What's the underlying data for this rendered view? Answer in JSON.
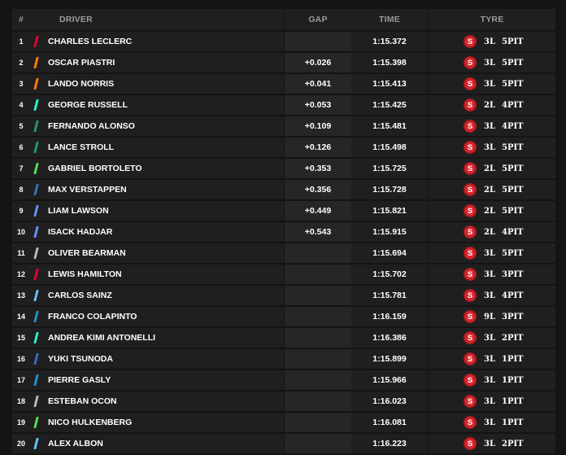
{
  "header": {
    "pos": "#",
    "driver": "DRIVER",
    "gap": "GAP",
    "time": "TIME",
    "tyre": "TYRE"
  },
  "rows": [
    {
      "pos": "1",
      "driver": "CHARLES LECLERC",
      "gap": "",
      "time": "1:15.372",
      "compound": "S",
      "laps": "3L",
      "pits": "5PIT",
      "team_color": "#e8002d"
    },
    {
      "pos": "2",
      "driver": "OSCAR PIASTRI",
      "gap": "+0.026",
      "time": "1:15.398",
      "compound": "S",
      "laps": "3L",
      "pits": "5PIT",
      "team_color": "#ff8000"
    },
    {
      "pos": "3",
      "driver": "LANDO NORRIS",
      "gap": "+0.041",
      "time": "1:15.413",
      "compound": "S",
      "laps": "3L",
      "pits": "5PIT",
      "team_color": "#ff8000"
    },
    {
      "pos": "4",
      "driver": "GEORGE RUSSELL",
      "gap": "+0.053",
      "time": "1:15.425",
      "compound": "S",
      "laps": "2L",
      "pits": "4PIT",
      "team_color": "#27f4d2"
    },
    {
      "pos": "5",
      "driver": "FERNANDO ALONSO",
      "gap": "+0.109",
      "time": "1:15.481",
      "compound": "S",
      "laps": "3L",
      "pits": "4PIT",
      "team_color": "#229971"
    },
    {
      "pos": "6",
      "driver": "LANCE STROLL",
      "gap": "+0.126",
      "time": "1:15.498",
      "compound": "S",
      "laps": "3L",
      "pits": "5PIT",
      "team_color": "#229971"
    },
    {
      "pos": "7",
      "driver": "GABRIEL BORTOLETO",
      "gap": "+0.353",
      "time": "1:15.725",
      "compound": "S",
      "laps": "2L",
      "pits": "5PIT",
      "team_color": "#52e252"
    },
    {
      "pos": "8",
      "driver": "MAX VERSTAPPEN",
      "gap": "+0.356",
      "time": "1:15.728",
      "compound": "S",
      "laps": "2L",
      "pits": "5PIT",
      "team_color": "#3671c6"
    },
    {
      "pos": "9",
      "driver": "LIAM LAWSON",
      "gap": "+0.449",
      "time": "1:15.821",
      "compound": "S",
      "laps": "2L",
      "pits": "5PIT",
      "team_color": "#6692ff"
    },
    {
      "pos": "10",
      "driver": "ISACK HADJAR",
      "gap": "+0.543",
      "time": "1:15.915",
      "compound": "S",
      "laps": "2L",
      "pits": "4PIT",
      "team_color": "#6692ff"
    },
    {
      "pos": "11",
      "driver": "OLIVER BEARMAN",
      "gap": "",
      "time": "1:15.694",
      "compound": "S",
      "laps": "3L",
      "pits": "5PIT",
      "team_color": "#b6babd"
    },
    {
      "pos": "12",
      "driver": "LEWIS HAMILTON",
      "gap": "",
      "time": "1:15.702",
      "compound": "S",
      "laps": "3L",
      "pits": "3PIT",
      "team_color": "#e8002d"
    },
    {
      "pos": "13",
      "driver": "CARLOS SAINZ",
      "gap": "",
      "time": "1:15.781",
      "compound": "S",
      "laps": "3L",
      "pits": "4PIT",
      "team_color": "#64c4ff"
    },
    {
      "pos": "14",
      "driver": "FRANCO COLAPINTO",
      "gap": "",
      "time": "1:16.159",
      "compound": "S",
      "laps": "9L",
      "pits": "3PIT",
      "team_color": "#2293d1"
    },
    {
      "pos": "15",
      "driver": "ANDREA KIMI ANTONELLI",
      "gap": "",
      "time": "1:16.386",
      "compound": "S",
      "laps": "3L",
      "pits": "2PIT",
      "team_color": "#27f4d2"
    },
    {
      "pos": "16",
      "driver": "YUKI TSUNODA",
      "gap": "",
      "time": "1:15.899",
      "compound": "S",
      "laps": "3L",
      "pits": "1PIT",
      "team_color": "#3671c6"
    },
    {
      "pos": "17",
      "driver": "PIERRE GASLY",
      "gap": "",
      "time": "1:15.966",
      "compound": "S",
      "laps": "3L",
      "pits": "1PIT",
      "team_color": "#2293d1"
    },
    {
      "pos": "18",
      "driver": "ESTEBAN OCON",
      "gap": "",
      "time": "1:16.023",
      "compound": "S",
      "laps": "3L",
      "pits": "1PIT",
      "team_color": "#b6babd"
    },
    {
      "pos": "19",
      "driver": "NICO HULKENBERG",
      "gap": "",
      "time": "1:16.081",
      "compound": "S",
      "laps": "3L",
      "pits": "1PIT",
      "team_color": "#52e252"
    },
    {
      "pos": "20",
      "driver": "ALEX ALBON",
      "gap": "",
      "time": "1:16.223",
      "compound": "S",
      "laps": "3L",
      "pits": "2PIT",
      "team_color": "#64c4ff"
    }
  ]
}
